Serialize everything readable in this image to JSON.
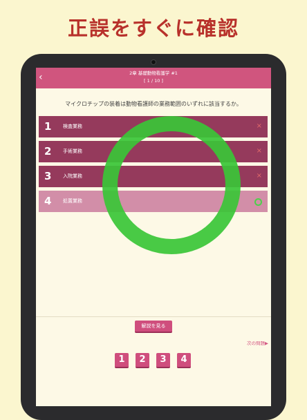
{
  "headline": "正誤をすぐに確認",
  "appbar": {
    "back_icon": "chevron-left-icon",
    "title": "2章 基礎動物看護学 #1",
    "counter": "[ 1 / 10 ]"
  },
  "question": "マイクロチップの装着は動物看護師の業務範囲のいずれに該当するか。",
  "options": [
    {
      "num": "1",
      "label": "検査業務",
      "result": "×"
    },
    {
      "num": "2",
      "label": "手術業務",
      "result": "×"
    },
    {
      "num": "3",
      "label": "入院業務",
      "result": "×"
    },
    {
      "num": "4",
      "label": "処置業務",
      "result": "correct"
    }
  ],
  "explain_label": "解説を見る",
  "next_label": "次の問題▶",
  "jump_buttons": [
    "1",
    "2",
    "3",
    "4"
  ],
  "colors": {
    "background": "#fbf6cf",
    "accent": "#d0557e",
    "option_wrong": "#953a5c",
    "option_correct": "#d28ea8",
    "correct_mark": "#39c637"
  }
}
